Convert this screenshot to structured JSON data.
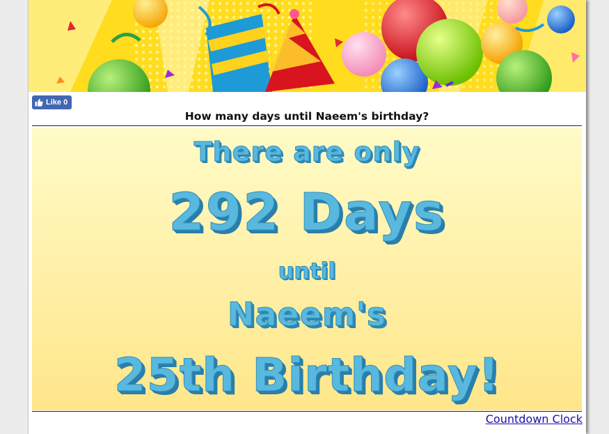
{
  "facebook": {
    "like_label": "Like 0"
  },
  "question": "How many days until Naeem's birthday?",
  "countdown": {
    "line1": "There are only",
    "line2": "292 Days",
    "line3": "until",
    "line4": "Naeem's",
    "line5": "25th Birthday!"
  },
  "footer": {
    "link_label": "Countdown Clock"
  },
  "colors": {
    "headline_text": "#59b8de",
    "headline_shadow": "#2e86b0",
    "box_top": "#fffbc7",
    "box_bottom": "#ffe68a",
    "facebook_blue": "#4267b2",
    "link": "#1a0dab"
  },
  "icons": {
    "banner": "birthday-banner-image",
    "like": "thumbs-up-icon"
  }
}
